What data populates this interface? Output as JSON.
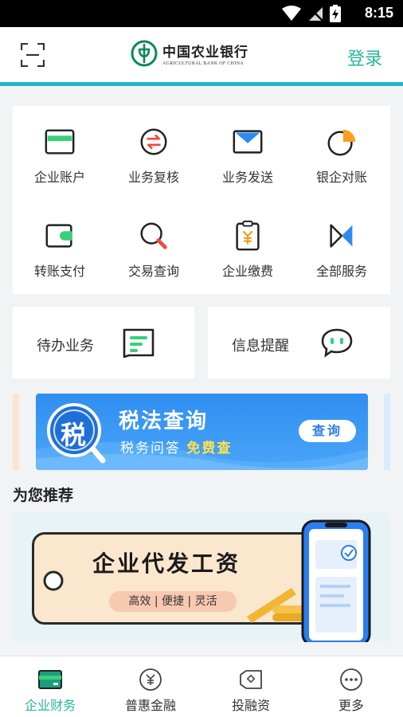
{
  "status_bar": {
    "time": "8:15",
    "icons": [
      "wifi-icon",
      "signal-off-icon",
      "battery-charging-icon"
    ]
  },
  "header": {
    "bank_name_cn": "中国农业银行",
    "bank_name_en": "AGRICULTURAL BANK OF CHINA",
    "login_label": "登录",
    "accent_color": "#27b79b",
    "line_color": "#1fb8c6"
  },
  "services": [
    {
      "label": "企业账户",
      "icon": "card-icon"
    },
    {
      "label": "业务复核",
      "icon": "transfer-review-icon"
    },
    {
      "label": "业务发送",
      "icon": "envelope-icon"
    },
    {
      "label": "银企对账",
      "icon": "pie-chart-icon"
    },
    {
      "label": "转账支付",
      "icon": "wallet-icon"
    },
    {
      "label": "交易查询",
      "icon": "search-icon"
    },
    {
      "label": "企业缴费",
      "icon": "yuan-bill-icon"
    },
    {
      "label": "全部服务",
      "icon": "all-services-icon"
    }
  ],
  "quick": {
    "todo": {
      "label": "待办业务",
      "icon": "todo-icon"
    },
    "notice": {
      "label": "信息提醒",
      "icon": "chat-bubble-icon"
    }
  },
  "banner": {
    "badge": "税",
    "title": "税法查询",
    "subtitle_prefix": "税务问答",
    "subtitle_highlight": "免费查",
    "button": "查询"
  },
  "recommend": {
    "title": "为您推荐",
    "promo_title": "企业代发工资",
    "promo_sub": "高效 | 便捷 | 灵活"
  },
  "bottom_nav": [
    {
      "label": "企业财务",
      "icon": "finance-icon",
      "active": true
    },
    {
      "label": "普惠金融",
      "icon": "yuan-circle-icon",
      "active": false
    },
    {
      "label": "投融资",
      "icon": "investment-tag-icon",
      "active": false
    },
    {
      "label": "更多",
      "icon": "more-dots-icon",
      "active": false
    }
  ]
}
